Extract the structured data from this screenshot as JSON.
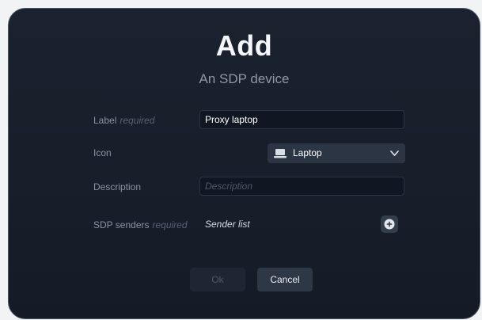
{
  "dialog": {
    "title": "Add",
    "subtitle": "An SDP device"
  },
  "fields": {
    "label": {
      "label": "Label",
      "required_tag": "required",
      "value": "Proxy laptop"
    },
    "icon": {
      "label": "Icon",
      "selected": "Laptop",
      "selected_icon": "laptop-icon"
    },
    "description": {
      "label": "Description",
      "placeholder": "Description",
      "value": ""
    },
    "sdp_senders": {
      "label": "SDP senders",
      "required_tag": "required",
      "list_text": "Sender list",
      "add_icon": "plus-circle-icon"
    }
  },
  "buttons": {
    "ok_label": "Ok",
    "cancel_label": "Cancel"
  },
  "colors": {
    "dialog_background": "#181f2b",
    "select_background": "#2c3544",
    "text_primary": "#ffffff",
    "text_muted": "#8a93a3"
  }
}
